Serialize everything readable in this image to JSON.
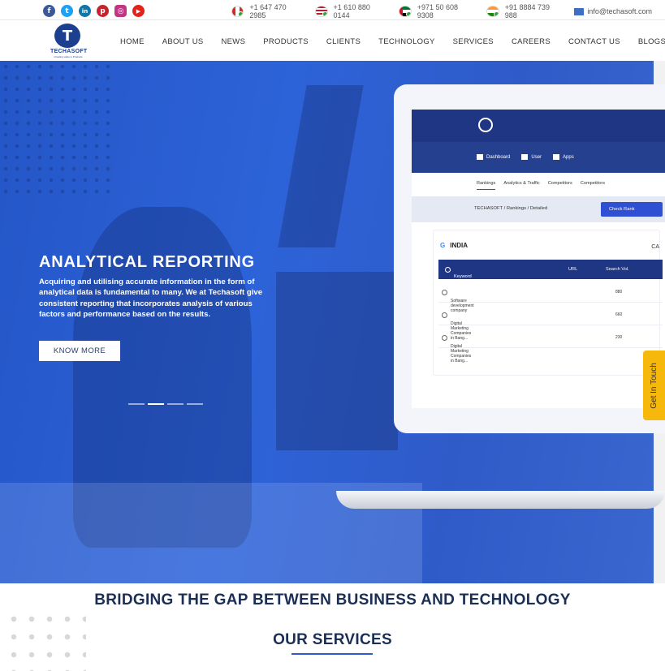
{
  "topbar": {
    "social": [
      {
        "name": "facebook",
        "glyph": "f",
        "color": "#3b5998"
      },
      {
        "name": "twitter",
        "glyph": "t",
        "color": "#1da1f2"
      },
      {
        "name": "linkedin",
        "glyph": "in",
        "color": "#0e76a8"
      },
      {
        "name": "pinterest",
        "glyph": "p",
        "color": "#c8232c"
      },
      {
        "name": "instagram",
        "glyph": "◎",
        "color": "#c13584"
      },
      {
        "name": "youtube",
        "glyph": "▶",
        "color": "#e62117"
      }
    ],
    "contacts": [
      {
        "flag": "canada",
        "phone": "+1 647 470 2985",
        "color": "#d52b1e"
      },
      {
        "flag": "usa",
        "phone": "+1 610 880 0144",
        "color": "#3c3b6e"
      },
      {
        "flag": "uae",
        "phone": "+971 50 608 9308",
        "color": "#00732f"
      },
      {
        "flag": "india",
        "phone": "+91 8884 739 988",
        "color": "#ff9933"
      }
    ],
    "email": "info@techasoft.com"
  },
  "nav": {
    "logo_text": "TECHASOFT",
    "logo_tagline": "Creating value in Products",
    "items": [
      "HOME",
      "ABOUT US",
      "NEWS",
      "PRODUCTS",
      "CLIENTS",
      "TECHNOLOGY",
      "SERVICES",
      "CAREERS",
      "CONTACT US",
      "BLOGS"
    ]
  },
  "hero": {
    "title": "ANALYTICAL REPORTING",
    "description": "Acquiring and utilising accurate information in the form of analytical data is fundamental to many. We at Techasoft give consistent reporting that incorporates analysis of various factors and performance based on the results.",
    "button": "KNOW MORE",
    "slides_total": 4,
    "slide_active": 2
  },
  "screen": {
    "menu": [
      "Dashboard",
      "User",
      "Apps"
    ],
    "tabs": [
      "Rankings",
      "Analytics & Traffic",
      "Competitors",
      "Competitors"
    ],
    "breadcrumb": "TECHASOFT / Rankings / Detailed",
    "check_button": "Check Rank",
    "country": "INDIA",
    "right_label": "CA",
    "columns": [
      "Keyword",
      "URL",
      "Search Vol."
    ],
    "rows": [
      {
        "keyword": "Software development company",
        "volume": "880"
      },
      {
        "keyword": "Digital Marketing Companies in Bang...",
        "volume": "660"
      },
      {
        "keyword": "Digital Marketing Companies in Bang...",
        "volume": "230"
      }
    ]
  },
  "touch": "Get In Touch",
  "sections": {
    "bridge": "BRIDGING THE GAP BETWEEN BUSINESS AND TECHNOLOGY",
    "services": "OUR SERVICES"
  }
}
